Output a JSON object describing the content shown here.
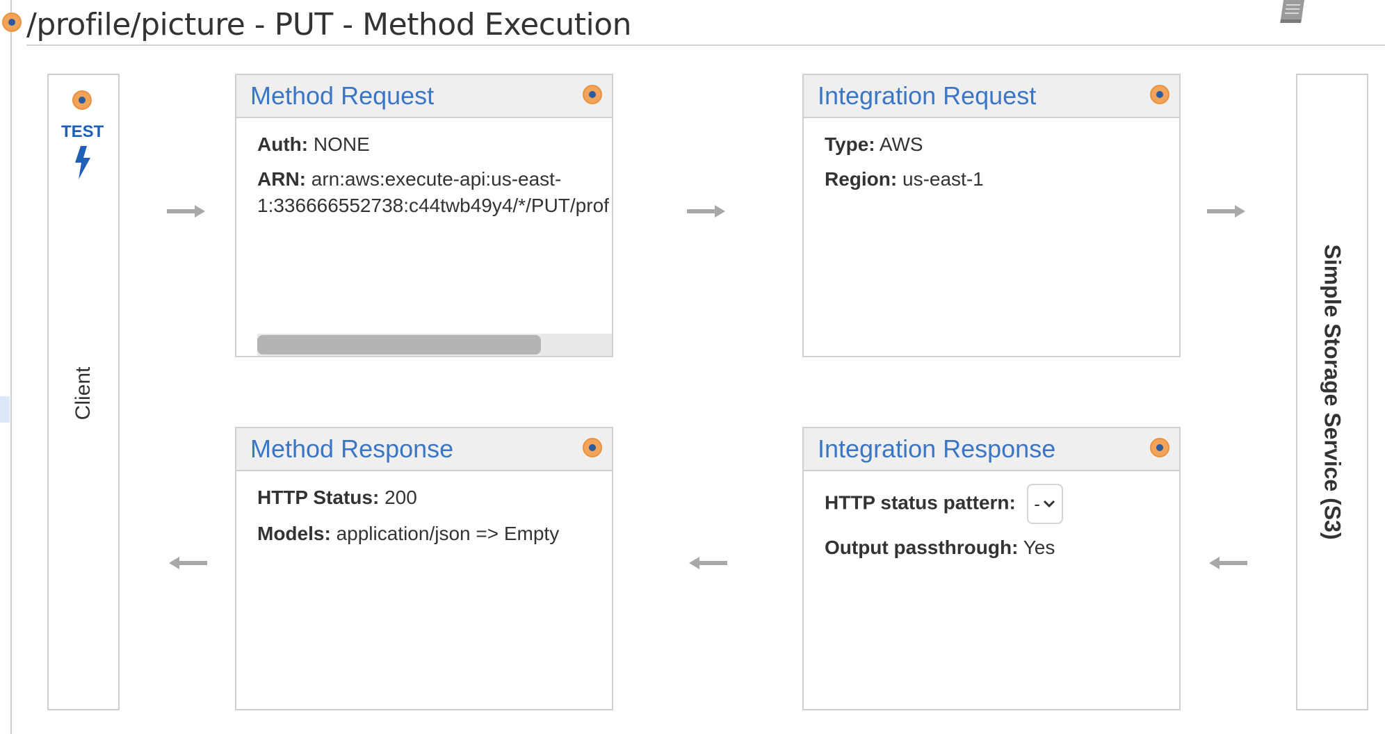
{
  "page": {
    "title": "/profile/picture - PUT - Method Execution"
  },
  "client": {
    "label": "Client",
    "test_label": "TEST"
  },
  "backend": {
    "label": "Simple Storage Service (S3)"
  },
  "method_request": {
    "title": "Method Request",
    "auth_key": "Auth:",
    "auth_value": "NONE",
    "arn_key": "ARN:",
    "arn_value_line1": "arn:aws:execute-api:us-east-",
    "arn_value_line2": "1:336666552738:c44twb49y4/*/PUT/prof"
  },
  "integration_request": {
    "title": "Integration Request",
    "type_key": "Type:",
    "type_value": "AWS",
    "region_key": "Region:",
    "region_value": "us-east-1"
  },
  "method_response": {
    "title": "Method Response",
    "status_key": "HTTP Status:",
    "status_value": "200",
    "models_key": "Models:",
    "models_value": "application/json => Empty"
  },
  "integration_response": {
    "title": "Integration Response",
    "pattern_key": "HTTP status pattern:",
    "pattern_selected": "-",
    "passthrough_key": "Output passthrough:",
    "passthrough_value": "Yes"
  },
  "colors": {
    "accent_blue": "#3a76c4",
    "test_blue": "#1e5fb8",
    "status_orange": "#f2a35a",
    "arrow_gray": "#a8a8a8"
  },
  "icons": {
    "docs": "book-icon",
    "test": "lightning-bolt-icon",
    "status": "status-dot-icon"
  }
}
